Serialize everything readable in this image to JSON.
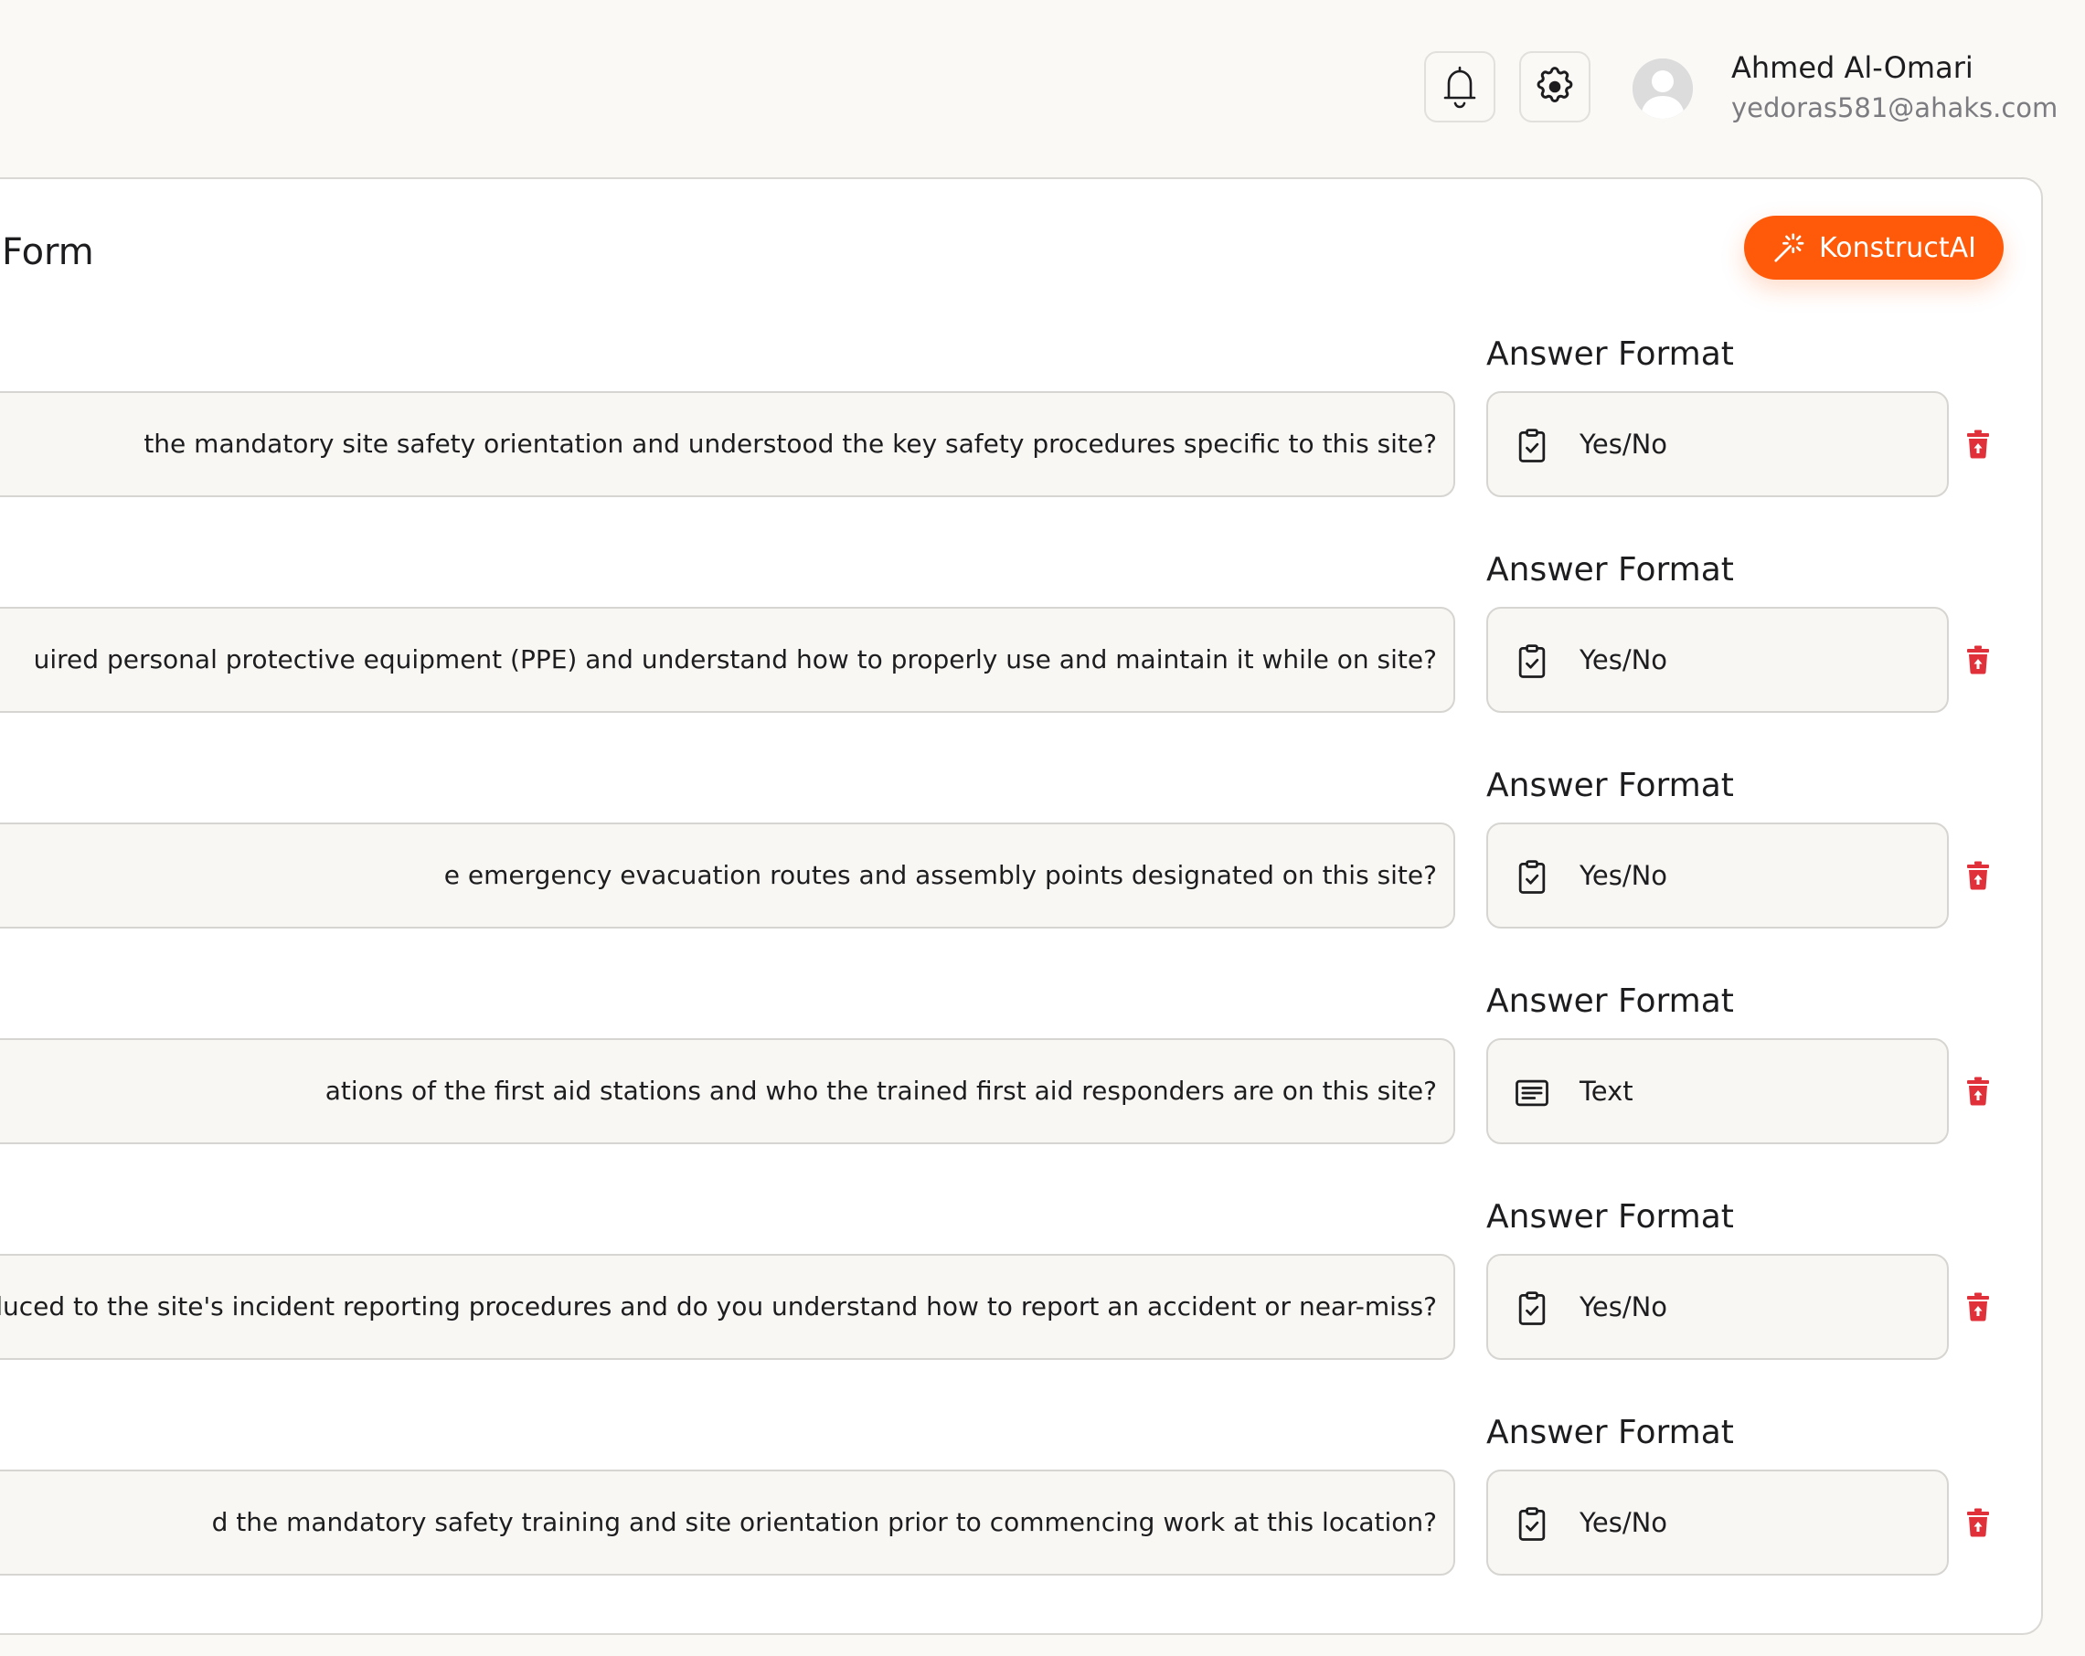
{
  "header": {
    "notifications_icon": "bell-icon",
    "settings_icon": "gear-icon",
    "user": {
      "name": "Ahmed Al-Omari",
      "email": "yedoras581@ahaks.com"
    }
  },
  "form": {
    "title": "Form",
    "ai_button_label": "KonstructAI",
    "ai_button_color": "#ff5a0a",
    "questions": [
      {
        "text": "the mandatory site safety orientation and understood the key safety procedures specific to this site?",
        "format_label": "Answer Format",
        "format": "Yes/No",
        "format_icon": "clipboard-check-icon"
      },
      {
        "text": "uired personal protective equipment (PPE) and understand how to properly use and maintain it while on site?",
        "format_label": "Answer Format",
        "format": "Yes/No",
        "format_icon": "clipboard-check-icon"
      },
      {
        "text": "e emergency evacuation routes and assembly points designated on this site?",
        "format_label": "Answer Format",
        "format": "Yes/No",
        "format_icon": "clipboard-check-icon"
      },
      {
        "text": "ations of the first aid stations and who the trained first aid responders are on this site?",
        "format_label": "Answer Format",
        "format": "Text",
        "format_icon": "text-lines-icon"
      },
      {
        "text": "duced to the site's incident reporting procedures and do you understand how to report an accident or near-miss?",
        "format_label": "Answer Format",
        "format": "Yes/No",
        "format_icon": "clipboard-check-icon"
      },
      {
        "text": "d the mandatory safety training and site orientation prior to commencing work at this location?",
        "format_label": "Answer Format",
        "format": "Yes/No",
        "format_icon": "clipboard-check-icon"
      }
    ]
  },
  "colors": {
    "background": "#faf9f6",
    "input_background": "#f8f7f3",
    "border": "#d6d5d1",
    "delete": "#e0303a",
    "muted_text": "#7b7b80"
  }
}
